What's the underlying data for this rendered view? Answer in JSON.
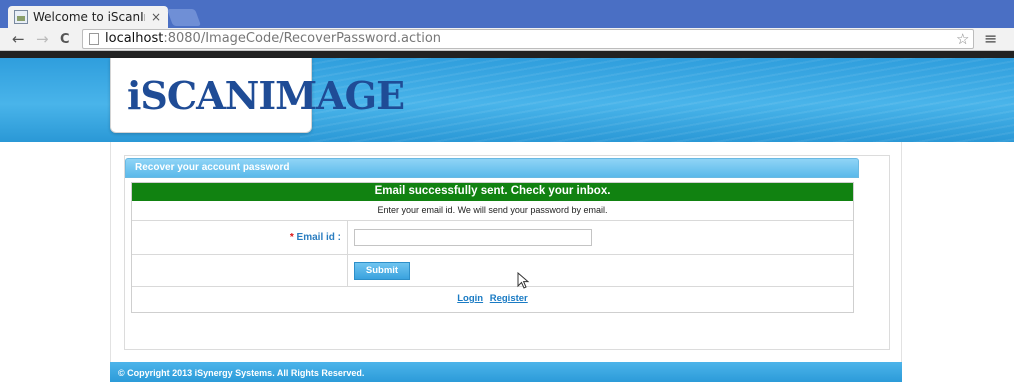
{
  "browser": {
    "tab_title": "Welcome to iScanImag",
    "tab_close": "×",
    "url_host": "localhost",
    "url_rest": ":8080/ImageCode/RecoverPassword.action",
    "back_glyph": "←",
    "forward_glyph": "→",
    "reload_glyph": "C",
    "star_glyph": "☆",
    "menu_glyph": "≡"
  },
  "site": {
    "logo_part1": "iSCAN",
    "logo_part2": "IMAGE"
  },
  "panel": {
    "title": "Recover your account password",
    "success_message": "Email successfully sent. Check your inbox.",
    "instruction": "Enter your email id. We will send your password by email.",
    "email_required_mark": "*",
    "email_label": "Email id :",
    "email_value": "",
    "submit_label": "Submit",
    "login_link": "Login",
    "register_link": "Register"
  },
  "footer": {
    "copyright": "© Copyright 2013 iSynergy Systems. All Rights Reserved."
  },
  "colors": {
    "brand_blue": "#2f9edd",
    "success_green": "#118211",
    "link_blue": "#1a7bc4",
    "logo_navy": "#1f4c96"
  },
  "icons": [
    "page-favicon",
    "close-icon",
    "back-arrow-icon",
    "forward-arrow-icon",
    "reload-icon",
    "page-icon",
    "bookmark-star-icon",
    "menu-icon",
    "mouse-cursor-icon"
  ]
}
